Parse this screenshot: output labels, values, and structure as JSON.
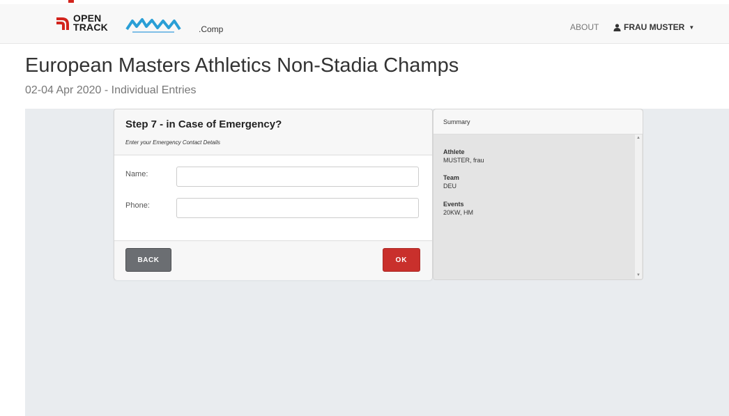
{
  "brand": {
    "logo_line1": "OPEN",
    "logo_line2": "TRACK",
    "suffix": ".Comp",
    "colors": {
      "red": "#d2231c",
      "blue": "#2a9fd6"
    }
  },
  "nav": {
    "about": "ABOUT",
    "user": "FRAU MUSTER",
    "user_icon": "user-icon",
    "caret_icon": "chevron-down-icon"
  },
  "page": {
    "title": "European Masters Athletics Non-Stadia Champs",
    "subtitle": "02-04 Apr 2020 - Individual Entries"
  },
  "step": {
    "title": "Step 7 - in Case of Emergency?",
    "instructions": "Enter your Emergency Contact Details",
    "fields": [
      {
        "label": "Name:",
        "value": "",
        "placeholder": ""
      },
      {
        "label": "Phone:",
        "value": "",
        "placeholder": ""
      }
    ],
    "back_label": "BACK",
    "ok_label": "OK",
    "colors": {
      "back": "#6b6e72",
      "ok": "#c9302c"
    }
  },
  "summary": {
    "title": "Summary",
    "athlete_label": "Athlete",
    "athlete_value": "MUSTER, frau",
    "team_label": "Team",
    "team_value": "DEU",
    "events_label": "Events",
    "events_value": "20KW, HM"
  }
}
